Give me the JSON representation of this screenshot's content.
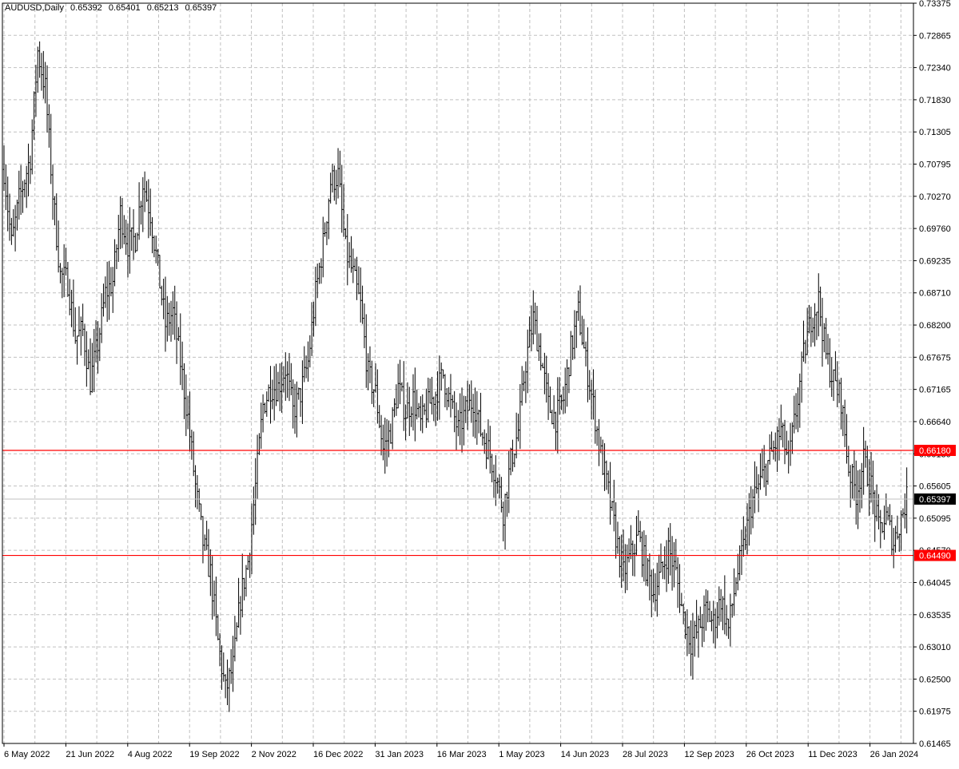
{
  "header": {
    "symbol": "AUDUSD,Daily",
    "open": "0.65392",
    "high": "0.65401",
    "low": "0.65213",
    "close": "0.65397"
  },
  "colors": {
    "bars": "#000000",
    "grid": "#c0c0c0",
    "level_line": "#ff0000",
    "level_label_bg": "#ff0000",
    "current_label_bg": "#000000",
    "current_line": "#c0c0c0"
  },
  "chart_data": {
    "type": "bar",
    "style": "OHLC bars",
    "symbol": "AUDUSD",
    "timeframe": "Daily",
    "grid": true,
    "ylim": [
      0.61465,
      0.73375
    ],
    "y_ticks": [
      "0.73375",
      "0.72865",
      "0.72340",
      "0.71830",
      "0.71305",
      "0.70795",
      "0.70270",
      "0.69760",
      "0.69235",
      "0.68710",
      "0.68200",
      "0.67675",
      "0.67165",
      "0.66640",
      "0.66130",
      "0.65605",
      "0.65095",
      "0.64570",
      "0.64045",
      "0.63535",
      "0.63010",
      "0.62500",
      "0.61975",
      "0.61465"
    ],
    "x_ticks": [
      "6 May 2022",
      "21 Jun 2022",
      "4 Aug 2022",
      "19 Sep 2022",
      "2 Nov 2022",
      "16 Dec 2022",
      "31 Jan 2023",
      "16 Mar 2023",
      "1 May 2023",
      "14 Jun 2023",
      "28 Jul 2023",
      "12 Sep 2023",
      "26 Oct 2023",
      "11 Dec 2023",
      "26 Jan 2024"
    ],
    "levels": [
      {
        "value": 0.6618,
        "label": "0.66180"
      },
      {
        "value": 0.6449,
        "label": "0.64490"
      }
    ],
    "current_price": {
      "value": 0.65397,
      "label": "0.65397"
    },
    "close_path": [
      [
        0,
        0.707
      ],
      [
        4,
        0.695
      ],
      [
        8,
        0.702
      ],
      [
        14,
        0.709
      ],
      [
        18,
        0.726
      ],
      [
        22,
        0.72
      ],
      [
        26,
        0.703
      ],
      [
        30,
        0.69
      ],
      [
        34,
        0.689
      ],
      [
        38,
        0.68
      ],
      [
        42,
        0.681
      ],
      [
        46,
        0.673
      ],
      [
        50,
        0.679
      ],
      [
        54,
        0.687
      ],
      [
        58,
        0.689
      ],
      [
        62,
        0.7
      ],
      [
        66,
        0.695
      ],
      [
        70,
        0.696
      ],
      [
        74,
        0.705
      ],
      [
        78,
        0.7
      ],
      [
        82,
        0.691
      ],
      [
        86,
        0.682
      ],
      [
        90,
        0.684
      ],
      [
        94,
        0.676
      ],
      [
        98,
        0.667
      ],
      [
        102,
        0.656
      ],
      [
        106,
        0.647
      ],
      [
        110,
        0.642
      ],
      [
        114,
        0.631
      ],
      [
        118,
        0.623
      ],
      [
        122,
        0.627
      ],
      [
        126,
        0.638
      ],
      [
        130,
        0.644
      ],
      [
        134,
        0.656
      ],
      [
        138,
        0.669
      ],
      [
        142,
        0.672
      ],
      [
        146,
        0.672
      ],
      [
        150,
        0.675
      ],
      [
        154,
        0.668
      ],
      [
        158,
        0.671
      ],
      [
        162,
        0.676
      ],
      [
        166,
        0.687
      ],
      [
        170,
        0.695
      ],
      [
        174,
        0.705
      ],
      [
        178,
        0.706
      ],
      [
        182,
        0.694
      ],
      [
        186,
        0.69
      ],
      [
        190,
        0.685
      ],
      [
        194,
        0.674
      ],
      [
        198,
        0.671
      ],
      [
        202,
        0.662
      ],
      [
        206,
        0.665
      ],
      [
        210,
        0.672
      ],
      [
        214,
        0.668
      ],
      [
        218,
        0.67
      ],
      [
        222,
        0.666
      ],
      [
        226,
        0.669
      ],
      [
        230,
        0.671
      ],
      [
        234,
        0.674
      ],
      [
        238,
        0.669
      ],
      [
        242,
        0.665
      ],
      [
        246,
        0.668
      ],
      [
        250,
        0.67
      ],
      [
        254,
        0.665
      ],
      [
        258,
        0.662
      ],
      [
        262,
        0.658
      ],
      [
        266,
        0.652
      ],
      [
        270,
        0.66
      ],
      [
        274,
        0.665
      ],
      [
        278,
        0.676
      ],
      [
        282,
        0.683
      ],
      [
        286,
        0.677
      ],
      [
        290,
        0.669
      ],
      [
        294,
        0.667
      ],
      [
        298,
        0.67
      ],
      [
        302,
        0.678
      ],
      [
        306,
        0.684
      ],
      [
        310,
        0.676
      ],
      [
        314,
        0.669
      ],
      [
        318,
        0.661
      ],
      [
        322,
        0.655
      ],
      [
        326,
        0.648
      ],
      [
        330,
        0.642
      ],
      [
        334,
        0.645
      ],
      [
        338,
        0.648
      ],
      [
        342,
        0.643
      ],
      [
        346,
        0.639
      ],
      [
        350,
        0.642
      ],
      [
        354,
        0.646
      ],
      [
        358,
        0.642
      ],
      [
        362,
        0.635
      ],
      [
        366,
        0.631
      ],
      [
        370,
        0.633
      ],
      [
        374,
        0.636
      ],
      [
        378,
        0.634
      ],
      [
        382,
        0.638
      ],
      [
        386,
        0.633
      ],
      [
        390,
        0.641
      ],
      [
        394,
        0.646
      ],
      [
        398,
        0.653
      ],
      [
        402,
        0.656
      ],
      [
        406,
        0.659
      ],
      [
        410,
        0.662
      ],
      [
        414,
        0.665
      ],
      [
        418,
        0.66
      ],
      [
        422,
        0.668
      ],
      [
        426,
        0.677
      ],
      [
        430,
        0.683
      ],
      [
        434,
        0.686
      ],
      [
        438,
        0.677
      ],
      [
        442,
        0.673
      ],
      [
        446,
        0.67
      ],
      [
        450,
        0.659
      ],
      [
        454,
        0.655
      ],
      [
        458,
        0.66
      ],
      [
        462,
        0.656
      ],
      [
        466,
        0.649
      ],
      [
        470,
        0.651
      ],
      [
        474,
        0.647
      ],
      [
        478,
        0.651
      ],
      [
        481,
        0.654
      ]
    ]
  }
}
